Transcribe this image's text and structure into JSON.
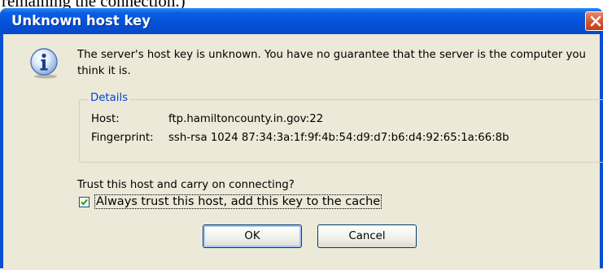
{
  "background": {
    "text": "remaining the connection.)"
  },
  "window": {
    "title": "Unknown host key",
    "title_color": "#ffffff",
    "titlebar_color": "#0652d8",
    "close_icon": "close-icon"
  },
  "message": "The server's host key is unknown. You have no guarantee that the server is the computer you think it is.",
  "details": {
    "legend": "Details",
    "host_label": "Host:",
    "host_value": "ftp.hamiltoncounty.in.gov:22",
    "fingerprint_label": "Fingerprint:",
    "fingerprint_value": "ssh-rsa 1024 87:34:3a:1f:9f:4b:54:d9:d7:b6:d4:92:65:1a:66:8b"
  },
  "question": "Trust this host and carry on connecting?",
  "checkbox": {
    "label": "Always trust this host, add this key to the cache",
    "checked": true
  },
  "buttons": {
    "ok": "OK",
    "cancel": "Cancel"
  },
  "accent_color": "#0046d5"
}
